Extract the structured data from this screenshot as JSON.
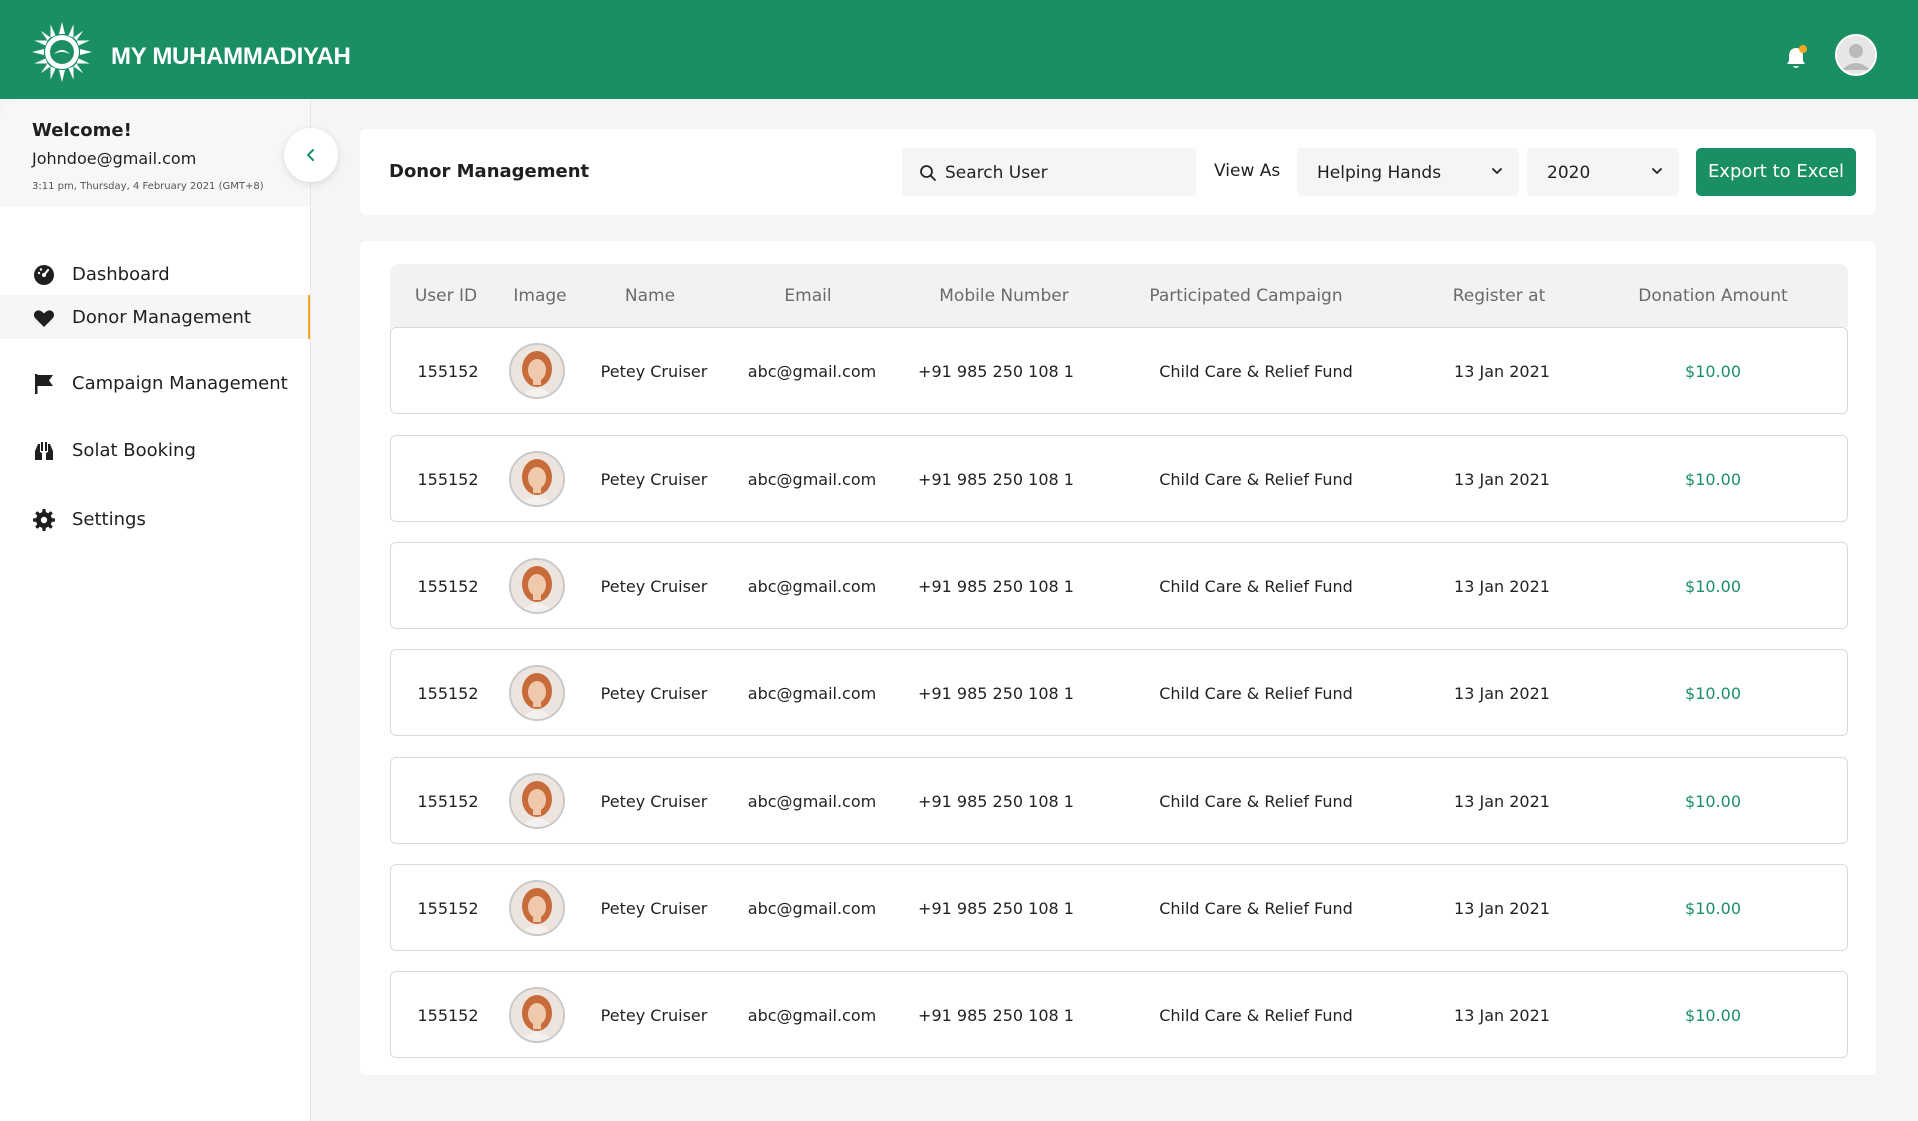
{
  "app": {
    "brand": "MY MUHAMMADIYAH"
  },
  "sidebar": {
    "welcome": "Welcome!",
    "email": "Johndoe@gmail.com",
    "timestamp": "3:11 pm, Thursday, 4 February 2021 (GMT+8)",
    "items": [
      {
        "label": "Dashboard",
        "icon": "dashboard-gauge-icon"
      },
      {
        "label": "Donor Management",
        "icon": "heart-icon",
        "active": true
      },
      {
        "label": "Campaign Management",
        "icon": "flag-icon"
      },
      {
        "label": "Solat Booking",
        "icon": "praying-hands-icon"
      },
      {
        "label": "Settings",
        "icon": "gear-icon"
      }
    ]
  },
  "toolbar": {
    "title": "Donor Management",
    "search_placeholder": "Search User",
    "view_as_label": "View As",
    "view_as_value": "Helping Hands",
    "year_value": "2020",
    "export_label": "Export to Excel"
  },
  "table": {
    "columns": [
      "User ID",
      "Image",
      "Name",
      "Email",
      "Mobile Number",
      "Participated Campaign",
      "Register at",
      "Donation Amount"
    ],
    "rows": [
      {
        "user_id": "155152",
        "name": "Petey Cruiser",
        "email": "abc@gmail.com",
        "mobile": "+91  985 250 108 1",
        "campaign": "Child Care & Relief Fund",
        "registered": "13 Jan 2021",
        "amount": "$10.00"
      },
      {
        "user_id": "155152",
        "name": "Petey Cruiser",
        "email": "abc@gmail.com",
        "mobile": "+91  985 250 108 1",
        "campaign": "Child Care & Relief Fund",
        "registered": "13 Jan 2021",
        "amount": "$10.00"
      },
      {
        "user_id": "155152",
        "name": "Petey Cruiser",
        "email": "abc@gmail.com",
        "mobile": "+91  985 250 108 1",
        "campaign": "Child Care & Relief Fund",
        "registered": "13 Jan 2021",
        "amount": "$10.00"
      },
      {
        "user_id": "155152",
        "name": "Petey Cruiser",
        "email": "abc@gmail.com",
        "mobile": "+91  985 250 108 1",
        "campaign": "Child Care & Relief Fund",
        "registered": "13 Jan 2021",
        "amount": "$10.00"
      },
      {
        "user_id": "155152",
        "name": "Petey Cruiser",
        "email": "abc@gmail.com",
        "mobile": "+91  985 250 108 1",
        "campaign": "Child Care & Relief Fund",
        "registered": "13 Jan 2021",
        "amount": "$10.00"
      },
      {
        "user_id": "155152",
        "name": "Petey Cruiser",
        "email": "abc@gmail.com",
        "mobile": "+91  985 250 108 1",
        "campaign": "Child Care & Relief Fund",
        "registered": "13 Jan 2021",
        "amount": "$10.00"
      },
      {
        "user_id": "155152",
        "name": "Petey Cruiser",
        "email": "abc@gmail.com",
        "mobile": "+91  985 250 108 1",
        "campaign": "Child Care & Relief Fund",
        "registered": "13 Jan 2021",
        "amount": "$10.00"
      }
    ]
  },
  "colors": {
    "brand_green": "#1b8f64",
    "active_accent": "#f5a623",
    "notification_dot": "#f5a623"
  }
}
